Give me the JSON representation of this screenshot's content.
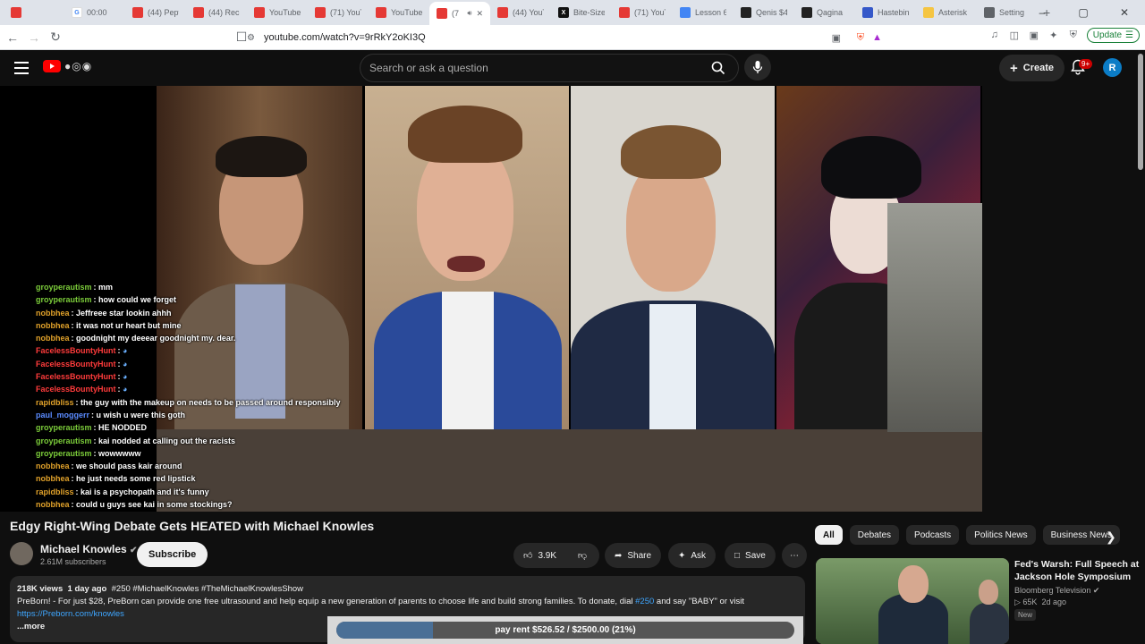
{
  "browser": {
    "tabs": [
      {
        "title": "",
        "icon": "yt"
      },
      {
        "title": "00:00",
        "icon": "g"
      },
      {
        "title": "(44) Pepte",
        "icon": "yt"
      },
      {
        "title": "(44) Recke",
        "icon": "yt"
      },
      {
        "title": "YouTube",
        "icon": "yt"
      },
      {
        "title": "(71) YouT",
        "icon": "yt"
      },
      {
        "title": "YouTube",
        "icon": "yt"
      },
      {
        "title": "(7",
        "icon": "yt",
        "active": true
      },
      {
        "title": "(44) YouT",
        "icon": "yt"
      },
      {
        "title": "Bite-Size",
        "icon": "x"
      },
      {
        "title": "(71) YouT",
        "icon": "yt"
      },
      {
        "title": "Lesson 6",
        "icon": "doc"
      },
      {
        "title": "Qenis $4",
        "icon": "q"
      },
      {
        "title": "Qagina",
        "icon": "q"
      },
      {
        "title": "Hastebin",
        "icon": "h"
      },
      {
        "title": "Asterisk",
        "icon": "ast"
      },
      {
        "title": "Setting",
        "icon": "set"
      }
    ],
    "url": "youtube.com/watch?v=9rRkY2oKI3Q",
    "update_label": "Update"
  },
  "youtube": {
    "search_placeholder": "Search or ask a question",
    "create_label": "Create",
    "notif_count": "9+",
    "avatar_letter": "R"
  },
  "chat": [
    {
      "user": "groyperautism",
      "msg": "mm",
      "color": "#7ccd3a"
    },
    {
      "user": "groyperautism",
      "msg": "how could we forget",
      "color": "#7ccd3a"
    },
    {
      "user": "nobbhea",
      "msg": "Jeffreee star lookin ahhh",
      "color": "#e0a12a"
    },
    {
      "user": "nobbhea",
      "msg": "it was not ur heart but mine",
      "color": "#e0a12a"
    },
    {
      "user": "nobbhea",
      "msg": "goodnight my deeear goodnight my. dear.",
      "color": "#e0a12a"
    },
    {
      "user": "FacelessBountyHunt",
      "msg": "",
      "color": "#ff3b3b"
    },
    {
      "user": "FacelessBountyHunt",
      "msg": "",
      "color": "#ff3b3b"
    },
    {
      "user": "FacelessBountyHunt",
      "msg": "",
      "color": "#ff3b3b"
    },
    {
      "user": "FacelessBountyHunt",
      "msg": "",
      "color": "#ff3b3b"
    },
    {
      "user": "rapidbliss",
      "msg": "the guy with the makeup on needs to be passed around responsibly",
      "color": "#e0a12a"
    },
    {
      "user": "paul_moggerr",
      "msg": "u wish u were this goth",
      "color": "#5a8bff"
    },
    {
      "user": "groyperautism",
      "msg": "HE NODDED",
      "color": "#7ccd3a"
    },
    {
      "user": "groyperautism",
      "msg": "kai nodded at calling out the racists",
      "color": "#7ccd3a"
    },
    {
      "user": "groyperautism",
      "msg": "wowwwww",
      "color": "#7ccd3a"
    },
    {
      "user": "nobbhea",
      "msg": "we should pass kair around",
      "color": "#e0a12a"
    },
    {
      "user": "nobbhea",
      "msg": "he just needs some red lipstick",
      "color": "#e0a12a"
    },
    {
      "user": "rapidbliss",
      "msg": "kai is a psychopath and it's funny",
      "color": "#e0a12a"
    },
    {
      "user": "nobbhea",
      "msg": "could u guys see kai in some stockings?",
      "color": "#e0a12a"
    },
    {
      "user": "nobbhea",
      "msg": "",
      "color": "#e0a12a"
    }
  ],
  "video": {
    "title": "Edgy Right-Wing Debate Gets HEATED with Michael Knowles",
    "channel": "Michael Knowles",
    "subscribers": "2.61M subscribers",
    "subscribe_label": "Subscribe",
    "likes": "3.9K",
    "share_label": "Share",
    "ask_label": "Ask",
    "save_label": "Save",
    "views": "218K views",
    "age": "1 day ago",
    "hashtags": "#250 #MichaelKnowles #TheMichaelKnowlesShow",
    "desc_line1_pre": "PreBorn! - For just $28, PreBorn can provide one free ultrasound and help equip a new generation of parents to choose life and build strong families. To donate, dial ",
    "desc_line1_link": "#250",
    "desc_line1_post": " and say \"BABY\" or visit",
    "desc_link": "https://Preborn.com/knowles",
    "more_label": "...more"
  },
  "goal": {
    "label": "pay rent $526.52 / $2500.00 (21%)",
    "fraction": 0.21
  },
  "chips": [
    "All",
    "Debates",
    "Podcasts",
    "Politics News",
    "Business News"
  ],
  "recommended": {
    "title": "Fed's Warsh: Full Speech at Jackson Hole Symposium",
    "channel": "Bloomberg Television",
    "views": "65K",
    "age": "2d ago",
    "badge": "New"
  }
}
